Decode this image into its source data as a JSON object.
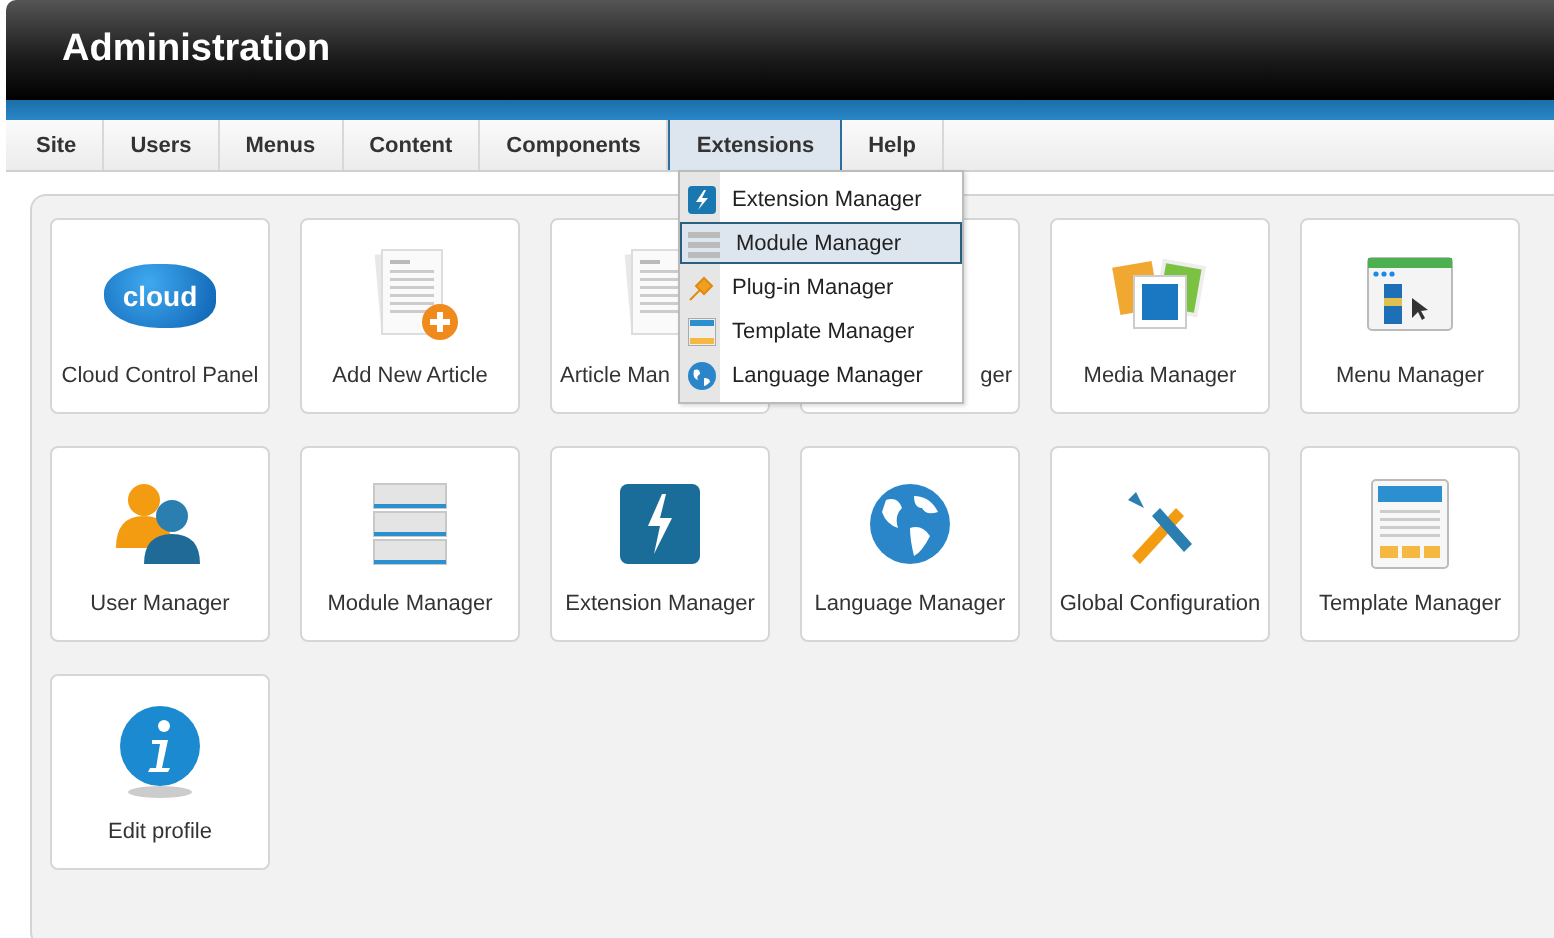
{
  "header": {
    "title": "Administration"
  },
  "menu": [
    {
      "label": "Site",
      "selected": false
    },
    {
      "label": "Users",
      "selected": false
    },
    {
      "label": "Menus",
      "selected": false
    },
    {
      "label": "Content",
      "selected": false
    },
    {
      "label": "Components",
      "selected": false
    },
    {
      "label": "Extensions",
      "selected": true
    },
    {
      "label": "Help",
      "selected": false
    }
  ],
  "dropdown": [
    {
      "label": "Extension Manager",
      "kind": "extension",
      "selected": false
    },
    {
      "label": "Module Manager",
      "kind": "module",
      "selected": true
    },
    {
      "label": "Plug-in Manager",
      "kind": "plugin",
      "selected": false
    },
    {
      "label": "Template Manager",
      "kind": "template",
      "selected": false
    },
    {
      "label": "Language Manager",
      "kind": "language",
      "selected": false
    }
  ],
  "tiles": [
    {
      "label": "Cloud Control Panel",
      "kind": "cloud",
      "icon_text": "cloud"
    },
    {
      "label": "Add New Article",
      "kind": "addarticle"
    },
    {
      "label": "Article Man",
      "kind": "clipped"
    },
    {
      "label": "ger",
      "kind": "covered"
    },
    {
      "label": "Media Manager",
      "kind": "media"
    },
    {
      "label": "Menu Manager",
      "kind": "menu"
    },
    {
      "label": "User Manager",
      "kind": "users"
    },
    {
      "label": "Module Manager",
      "kind": "module"
    },
    {
      "label": "Extension Manager",
      "kind": "extension"
    },
    {
      "label": "Language Manager",
      "kind": "language"
    },
    {
      "label": "Global Configuration",
      "kind": "config"
    },
    {
      "label": "Template Manager",
      "kind": "template"
    },
    {
      "label": "Edit profile",
      "kind": "info"
    }
  ]
}
